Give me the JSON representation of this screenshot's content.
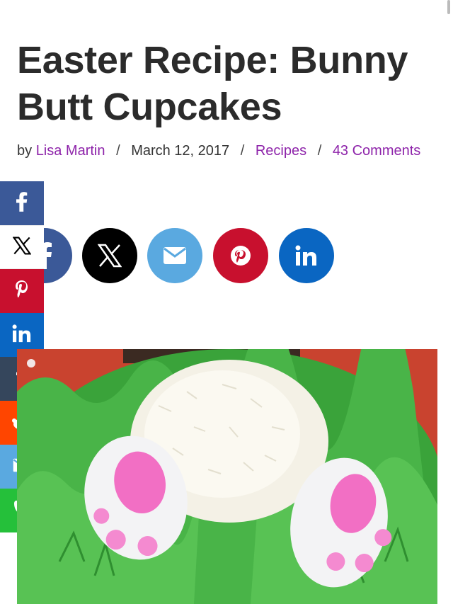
{
  "article": {
    "title": "Easter Recipe: Bunny Butt Cupcakes",
    "by_label": "by",
    "author": "Lisa Martin",
    "separator": "/",
    "date": "March 12, 2017",
    "category": "Recipes",
    "comments": "43 Comments"
  },
  "share_row": [
    {
      "name": "facebook",
      "icon": "facebook-icon",
      "color": "#3b5998"
    },
    {
      "name": "x",
      "icon": "x-icon",
      "color": "#000000"
    },
    {
      "name": "email",
      "icon": "email-icon",
      "color": "#5aa9e0"
    },
    {
      "name": "pinterest",
      "icon": "pinterest-icon",
      "color": "#c8102e"
    },
    {
      "name": "linkedin",
      "icon": "linkedin-icon",
      "color": "#0a66c2"
    }
  ],
  "side_share": [
    {
      "name": "facebook",
      "icon": "facebook-icon",
      "color": "#3b5998"
    },
    {
      "name": "x",
      "icon": "x-icon",
      "color": "#ffffff"
    },
    {
      "name": "pinterest",
      "icon": "pinterest-icon",
      "color": "#c8102e"
    },
    {
      "name": "linkedin",
      "icon": "linkedin-icon",
      "color": "#0a66c2"
    },
    {
      "name": "tumblr",
      "icon": "tumblr-icon",
      "color": "#35465c"
    },
    {
      "name": "reddit",
      "icon": "reddit-icon",
      "color": "#ff4500"
    },
    {
      "name": "email",
      "icon": "email-icon",
      "color": "#5aa9e0"
    },
    {
      "name": "whatsapp",
      "icon": "phone-icon",
      "color": "#25c03a"
    }
  ]
}
